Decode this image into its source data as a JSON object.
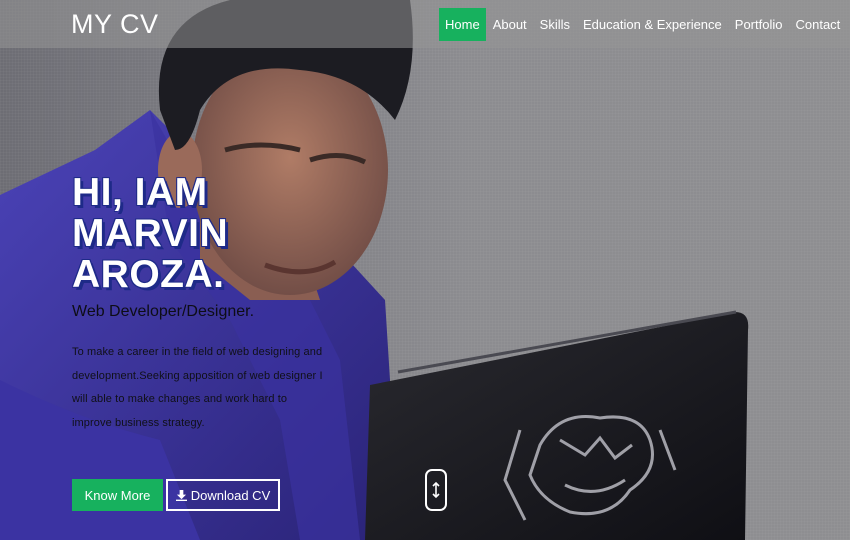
{
  "brand": "MY CV",
  "nav": {
    "items": [
      "Home",
      "About",
      "Skills",
      "Education & Experience",
      "Portfolio",
      "Contact"
    ],
    "active": "Home"
  },
  "hero": {
    "headline_lines": [
      "HI, IAM",
      "MARVIN",
      "AROZA."
    ],
    "role": "Web Developer/Designer.",
    "bio": "To make a career in the field of web designing and development.Seeking apposition of web designer I will able to make changes and work hard to improve business strategy.",
    "buttons": {
      "know_more": "Know More",
      "download_cv": "Download CV",
      "download_icon": "download-icon"
    },
    "scroll_icon": "up-down-arrow-icon"
  },
  "colors": {
    "accent_green": "#17b15e",
    "headline_shadow": "#1e2a88",
    "shirt_blue": "#4a3fb0"
  }
}
